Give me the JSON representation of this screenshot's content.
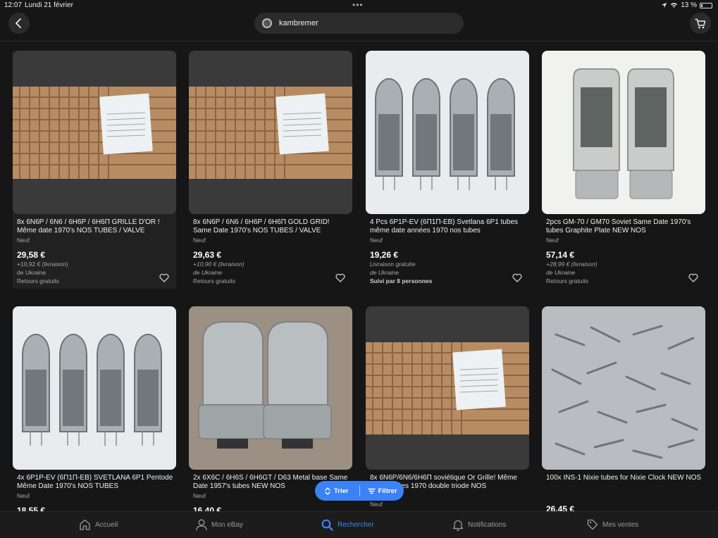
{
  "status_bar": {
    "time": "12:07",
    "date": "Lundi 21 février",
    "battery": "13 %",
    "battery_level": 0.13
  },
  "header": {
    "search_query": "kambremer"
  },
  "listings": [
    {
      "title": "8x 6N6P / 6N6 / 6H6P / 6Н6П GRILLE D'OR ! Même date 1970's NOS TUBES / VALVE",
      "condition": "Neuf",
      "price": "29,58 €",
      "shipping": "+10,92 € (livraison)",
      "origin": "de Ukraine",
      "extra": "Retours gratuits"
    },
    {
      "title": "8x 6N6P / 6N6 / 6H6P / 6Н6П GOLD GRID! Same Date 1970's NOS TUBES / VALVE",
      "condition": "Neuf",
      "price": "29,63 €",
      "shipping": "+10,90 € (livraison)",
      "origin": "de Ukraine",
      "extra": "Retours gratuits"
    },
    {
      "title": "4 Pcs 6P1P-EV (6П1П-ЕВ) Svetlana 6P1 tubes même date années 1970 nos tubes",
      "condition": "Neuf",
      "price": "19,26 €",
      "shipping": "Livraison gratuite",
      "origin": "de Ukraine",
      "extra": "Suivi par 8 personnes"
    },
    {
      "title": "2pcs GM-70 / GM70 Soviet Same Date 1970's tubes Graphite Plate NEW NOS",
      "condition": "Neuf",
      "price": "57,14 €",
      "shipping": "+28,99 € (livraison)",
      "origin": "de Ukraine",
      "extra": "Retours gratuits"
    },
    {
      "title": "4x 6P1P-EV (6П1П-ЕВ) SVETLANA 6P1 Pentode Même Date 1970's NOS TUBES",
      "condition": "Neuf",
      "price": "18,55 €"
    },
    {
      "title": "2x 6X6C / 6H6S / 6H6GT / D63 Metal base Same Date 1957's tubes NEW NOS",
      "condition": "Neuf",
      "price": "16,40 €"
    },
    {
      "title": "8x 6N6P/6N6/6Н6П soviétique Or Grille! Même date années 1970 double triode NOS",
      "condition": "Neuf",
      "price": ""
    },
    {
      "title": "100x INS-1 Nixie tubes for Nixie Clock NEW NOS",
      "condition": "",
      "price": "26,45 €"
    }
  ],
  "floating_bar": {
    "sort_label": "Trier",
    "filter_label": "Filtrer"
  },
  "tabbar": {
    "home": "Accueil",
    "my_ebay": "Mon eBay",
    "search": "Rechercher",
    "notifications": "Notifications",
    "selling": "Mes ventes"
  },
  "colors": {
    "accent": "#3b82f6",
    "background": "#161616"
  }
}
